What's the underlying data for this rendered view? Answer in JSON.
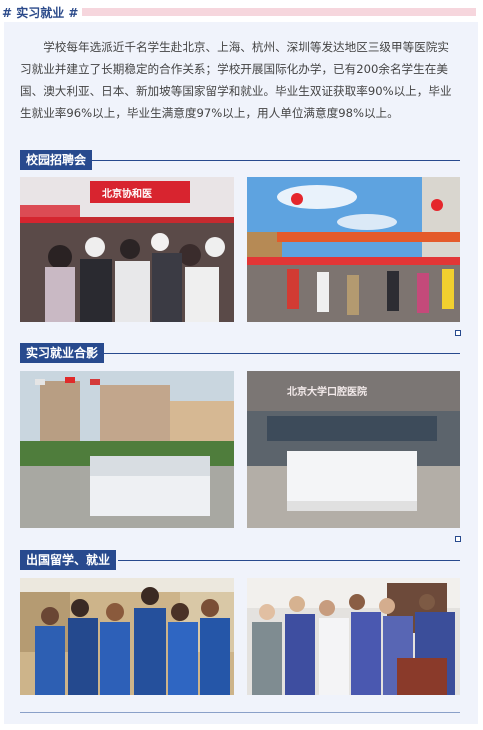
{
  "header": {
    "title": "# 实习就业 #"
  },
  "intro": "学校每年选派近千名学生赴北京、上海、杭州、深圳等发达地区三级甲等医院实习就业并建立了长期稳定的合作关系；学校开展国际化办学，已有200余名学生在美国、澳大利亚、日本、新加坡等国家留学和就业。毕业生双证获取率90%以上，毕业生就业率96%以上，毕业生满意度97%以上，用人单位满意度98%以上。",
  "sections": [
    {
      "title": "校园招聘会",
      "photos": [
        {
          "name": "campus-job-fair-booth-photo",
          "sign": "北京协和医"
        },
        {
          "name": "campus-job-fair-street-photo",
          "sign": ""
        }
      ]
    },
    {
      "title": "实习就业合影",
      "photos": [
        {
          "name": "interns-group-photo-outdoor",
          "sign": ""
        },
        {
          "name": "interns-group-photo-hospital",
          "sign": "北京大学口腔医院"
        }
      ]
    },
    {
      "title": "出国留学、就业",
      "photos": [
        {
          "name": "overseas-nurses-group-photo",
          "sign": ""
        },
        {
          "name": "overseas-staff-group-photo",
          "sign": ""
        }
      ]
    }
  ],
  "colors": {
    "accent": "#284a8e",
    "header_pink": "#f6d6dd",
    "panel_bg": "#f0f3fb"
  }
}
